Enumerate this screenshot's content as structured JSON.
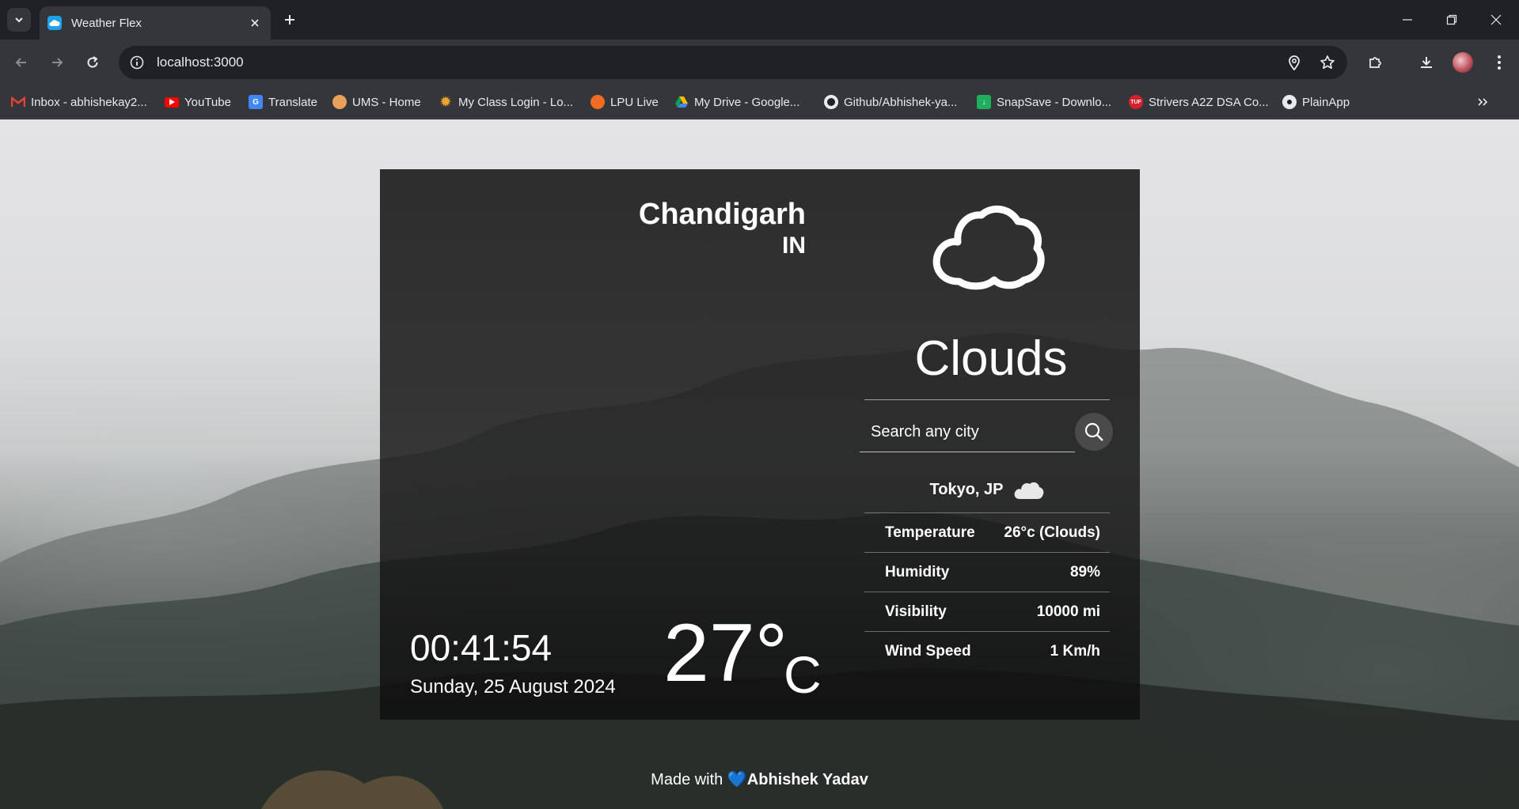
{
  "browser": {
    "tab_title": "Weather Flex",
    "url": "localhost:3000",
    "bookmarks": [
      {
        "label": "Inbox - abhishekay2...",
        "icon": "gmail-icon"
      },
      {
        "label": "YouTube",
        "icon": "youtube-icon"
      },
      {
        "label": "Translate",
        "icon": "translate-icon"
      },
      {
        "label": "UMS - Home",
        "icon": "ums-icon"
      },
      {
        "label": "My Class Login - Lo...",
        "icon": "sun-icon"
      },
      {
        "label": "LPU Live",
        "icon": "lpu-icon"
      },
      {
        "label": "My Drive - Google...",
        "icon": "drive-icon"
      },
      {
        "label": "Github/Abhishek-ya...",
        "icon": "github-icon"
      },
      {
        "label": "SnapSave - Downlo...",
        "icon": "download-icon"
      },
      {
        "label": "Strivers A2Z DSA Co...",
        "icon": "tuf-icon"
      },
      {
        "label": "PlainApp",
        "icon": "plainapp-icon"
      }
    ]
  },
  "weather": {
    "city": "Chandigarh",
    "country": "IN",
    "condition": "Clouds",
    "time": "00:41:54",
    "date": "Sunday, 25 August 2024",
    "temperature": "27°",
    "unit": "C",
    "search_placeholder": "Search any city",
    "searched_location": "Tokyo, JP",
    "stats": [
      {
        "label": "Temperature",
        "value": "26°c (Clouds)"
      },
      {
        "label": "Humidity",
        "value": "89%"
      },
      {
        "label": "Visibility",
        "value": "10000 mi"
      },
      {
        "label": "Wind Speed",
        "value": "1 Km/h"
      }
    ]
  },
  "footer": {
    "prefix": "Made with",
    "heart": "💙",
    "author": "Abhishek Yadav"
  },
  "colors": {
    "chrome_dark": "#202124",
    "chrome_toolbar": "#35363a",
    "heart": "#7ec8f2"
  }
}
